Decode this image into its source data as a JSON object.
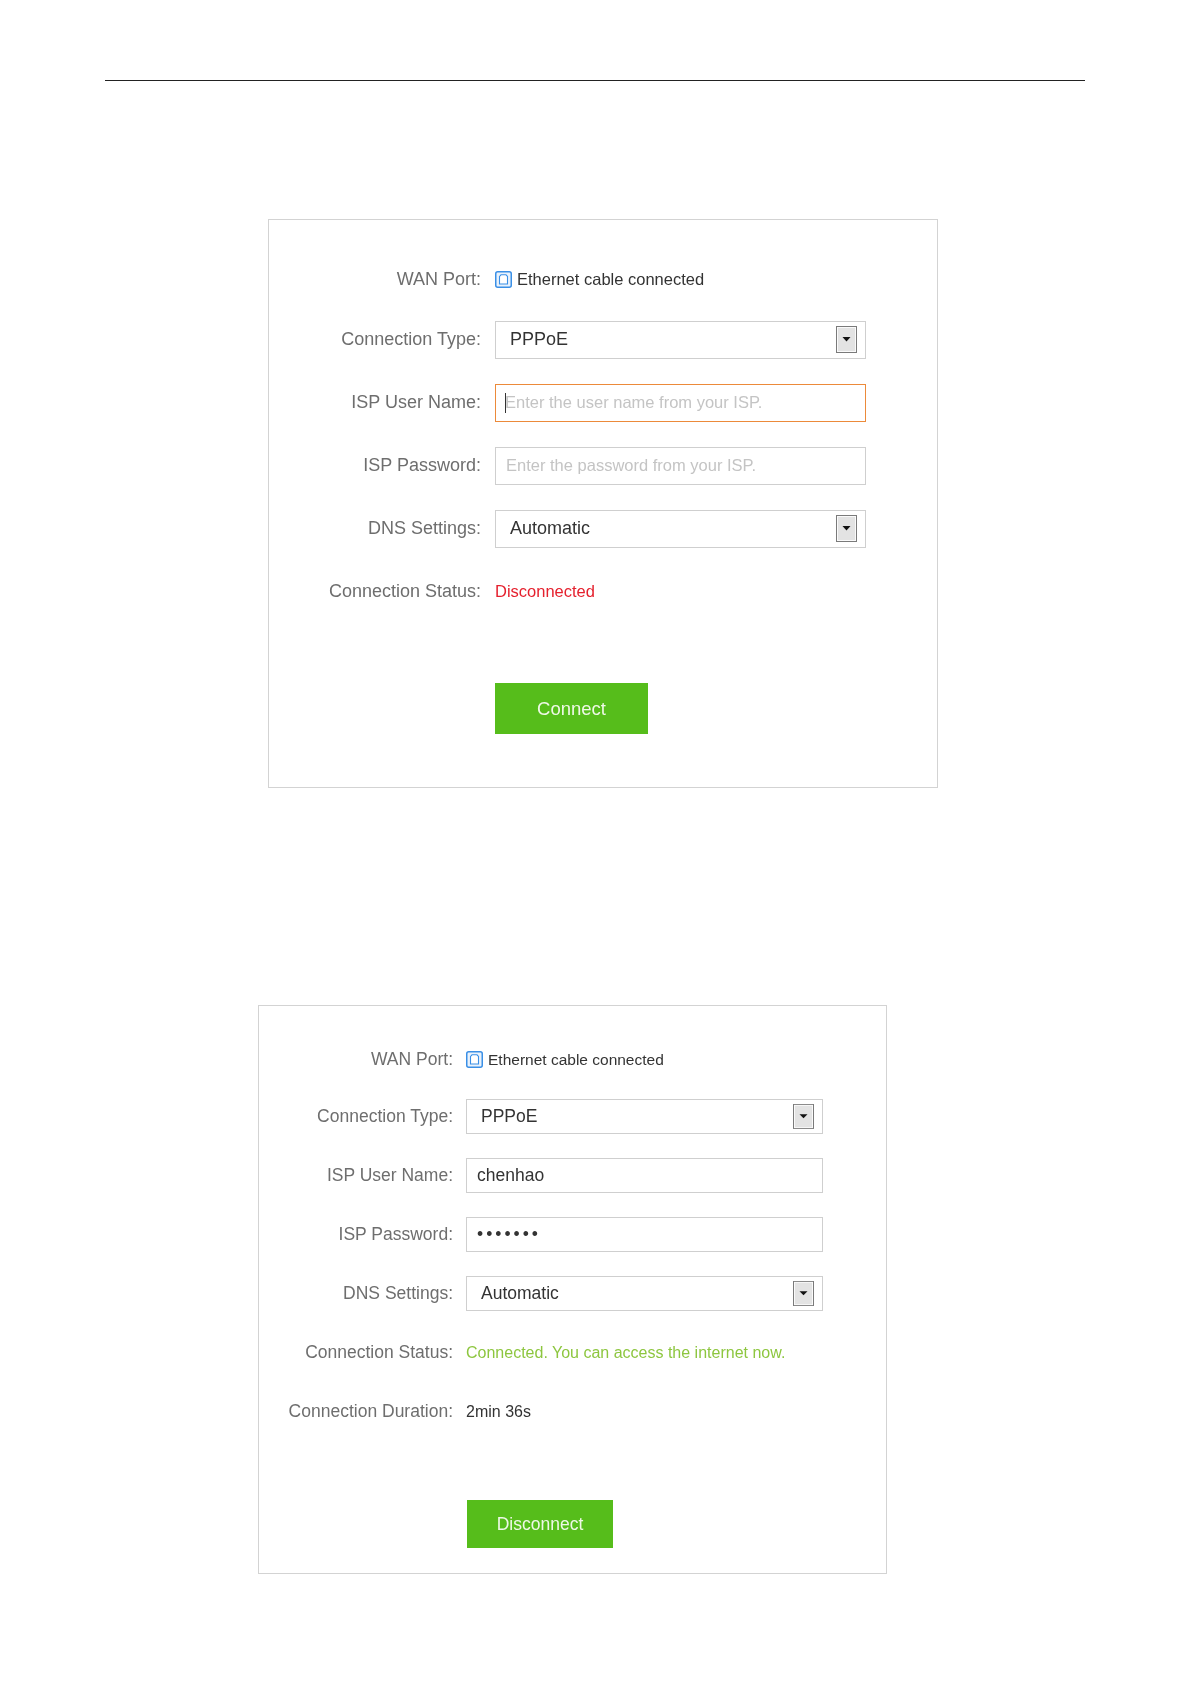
{
  "panels": [
    {
      "rows": [
        {
          "kind": "port",
          "label": "WAN Port:",
          "text": "Ethernet cable connected"
        },
        {
          "kind": "select",
          "label": "Connection Type:",
          "value": "PPPoE"
        },
        {
          "kind": "input",
          "label": "ISP User Name:",
          "placeholder": "Enter the user name from your ISP.",
          "focused": true
        },
        {
          "kind": "password",
          "label": "ISP Password:",
          "placeholder": "Enter the password from your ISP.",
          "focused": false
        },
        {
          "kind": "select",
          "label": "DNS Settings:",
          "value": "Automatic"
        },
        {
          "kind": "status",
          "label": "Connection Status:",
          "text": "Disconnected",
          "connected": false
        }
      ],
      "button": "Connect"
    },
    {
      "rows": [
        {
          "kind": "port",
          "label": "WAN Port:",
          "text": "Ethernet cable connected"
        },
        {
          "kind": "select",
          "label": "Connection Type:",
          "value": "PPPoE"
        },
        {
          "kind": "input",
          "label": "ISP User Name:",
          "value": "chenhao",
          "focused": false
        },
        {
          "kind": "password",
          "label": "ISP Password:",
          "value": "•••••••",
          "focused": false
        },
        {
          "kind": "select",
          "label": "DNS Settings:",
          "value": "Automatic"
        },
        {
          "kind": "status",
          "label": "Connection Status:",
          "text": "Connected. You can access the internet now.",
          "connected": true
        },
        {
          "kind": "text",
          "label": "Connection Duration:",
          "text": "2min 36s"
        }
      ],
      "button": "Disconnect"
    }
  ]
}
